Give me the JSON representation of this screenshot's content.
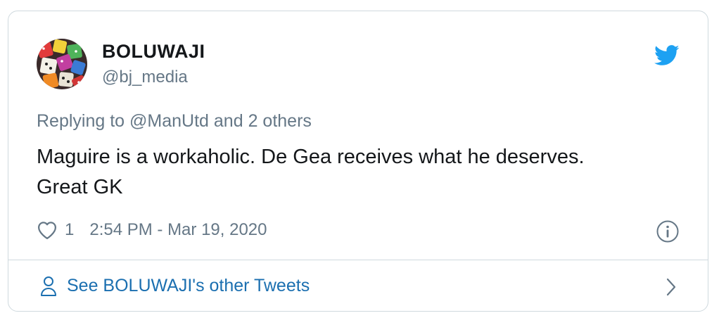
{
  "user": {
    "display_name": "BOLUWAJI",
    "handle": "@bj_media",
    "avatar_icon": "dice-avatar"
  },
  "tweet": {
    "reply_prefix": "Replying to",
    "reply_mention": "@ManUtd",
    "reply_suffix": "and 2 others",
    "text_line1": "Maguire is a workaholic. De Gea receives what he deserves.",
    "text_line2": "Great GK",
    "likes": "1",
    "timestamp": "2:54 PM - Mar 19, 2020"
  },
  "footer": {
    "label": "See BOLUWAJI's other Tweets"
  },
  "icons": {
    "brand": "twitter-bird-icon",
    "like": "heart-icon",
    "info": "info-icon",
    "profile": "person-icon",
    "more": "chevron-right-icon"
  },
  "colors": {
    "twitter_blue": "#1da1f2",
    "link_blue": "#1b6fb0",
    "muted_text": "#657786",
    "primary_text": "#14171a",
    "border": "#cfd9de"
  }
}
